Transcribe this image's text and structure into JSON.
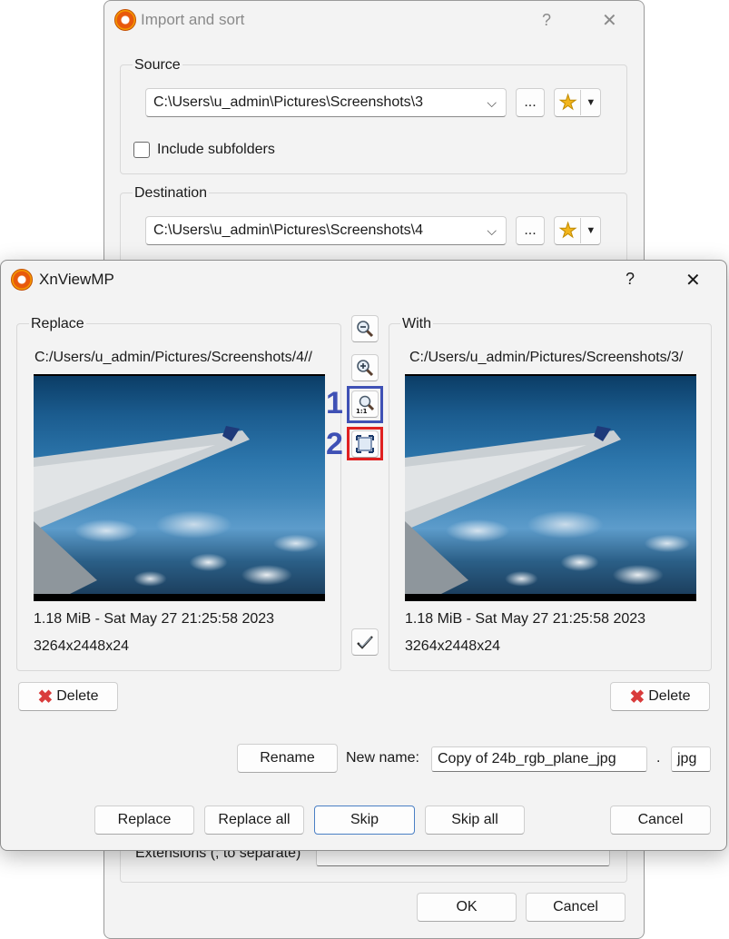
{
  "import_dialog": {
    "title": "Import and sort",
    "help_label": "?",
    "close_label": "✕",
    "source": {
      "label": "Source",
      "path": "C:\\Users\\u_admin\\Pictures\\Screenshots\\3",
      "browse_label": "...",
      "include_subfolders_label": "Include subfolders",
      "include_subfolders_checked": false
    },
    "destination": {
      "label": "Destination",
      "path": "C:\\Users\\u_admin\\Pictures\\Screenshots\\4",
      "browse_label": "..."
    },
    "extensions_label": "Extensions (; to separate)",
    "extensions_value": "",
    "ok_label": "OK",
    "cancel_label": "Cancel"
  },
  "conflict_dialog": {
    "title": "XnViewMP",
    "help_label": "?",
    "close_label": "✕",
    "replace_panel": {
      "label": "Replace",
      "path": "C:/Users/u_admin/Pictures/Screenshots/4//",
      "file_info": "1.18 MiB - Sat May 27 21:25:58 2023",
      "dimensions": "3264x2448x24",
      "delete_label": "Delete"
    },
    "with_panel": {
      "label": "With",
      "path": "C:/Users/u_admin/Pictures/Screenshots/3/",
      "file_info": "1.18 MiB - Sat May 27 21:25:58 2023",
      "dimensions": "3264x2448x24",
      "delete_label": "Delete"
    },
    "annotations": {
      "one": "1",
      "two": "2",
      "one_color": "#3f51b5",
      "two_color": "#e02020"
    },
    "rename_label": "Rename",
    "new_name_label": "New name:",
    "new_name_value": "Copy of 24b_rgb_plane_jpg",
    "dot_label": ".",
    "extension_value": "jpg",
    "buttons": {
      "replace": "Replace",
      "replace_all": "Replace all",
      "skip": "Skip",
      "skip_all": "Skip all",
      "cancel": "Cancel"
    }
  }
}
